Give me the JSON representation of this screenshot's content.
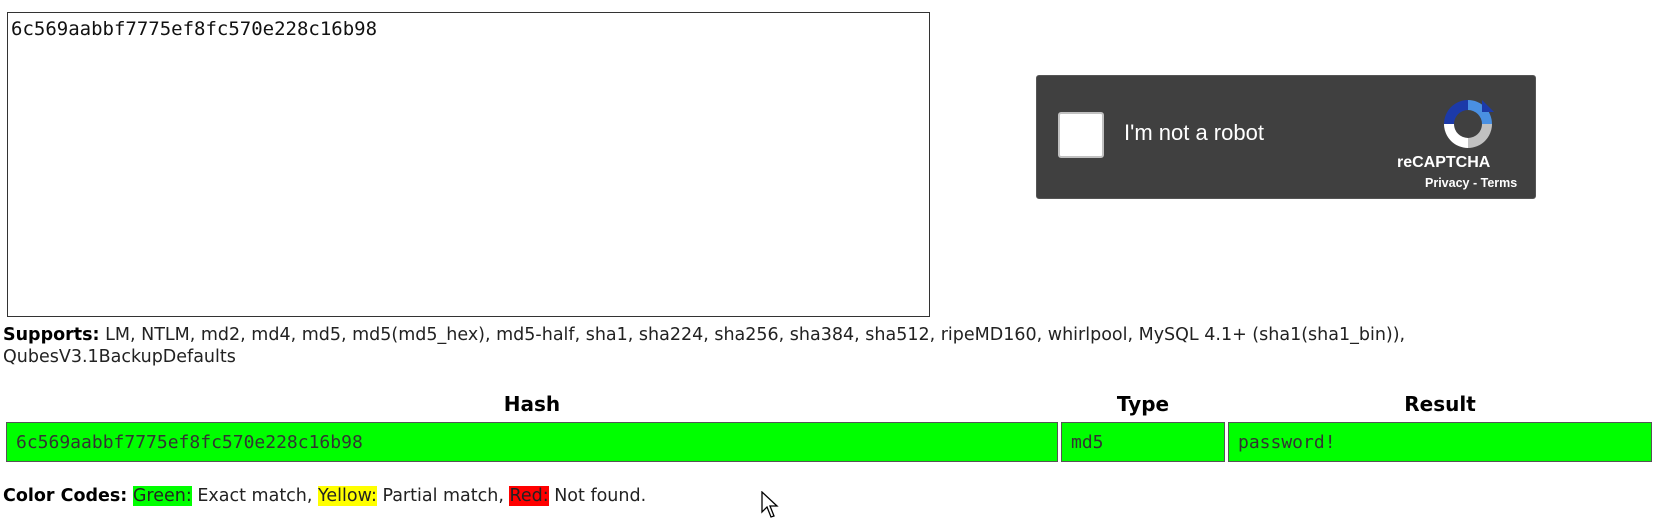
{
  "hash_input": {
    "value": "6c569aabbf7775ef8fc570e228c16b98"
  },
  "captcha": {
    "label": "I'm not a robot",
    "brand": "reCAPTCHA",
    "privacy": "Privacy",
    "separator": "-",
    "terms": "Terms",
    "icon": "recaptcha-logo-icon",
    "background": "#404040"
  },
  "supports": {
    "label": "Supports:",
    "text": "LM, NTLM, md2, md4, md5, md5(md5_hex), md5-half, sha1, sha224, sha256, sha384, sha512, ripeMD160, whirlpool, MySQL 4.1+ (sha1(sha1_bin)), QubesV3.1BackupDefaults"
  },
  "results": {
    "headers": [
      "Hash",
      "Type",
      "Result"
    ],
    "rows": [
      {
        "hash": "6c569aabbf7775ef8fc570e228c16b98",
        "type": "md5",
        "result": "password!",
        "status_color": "#00ff00"
      }
    ]
  },
  "legend": {
    "label": "Color Codes:",
    "green_label": "Green:",
    "green_text": "Exact match,",
    "yellow_label": "Yellow:",
    "yellow_text": "Partial match,",
    "red_label": "Red:",
    "red_text": "Not found.",
    "colors": {
      "green": "#00ff00",
      "yellow": "#ffff00",
      "red": "#ff0000"
    }
  }
}
